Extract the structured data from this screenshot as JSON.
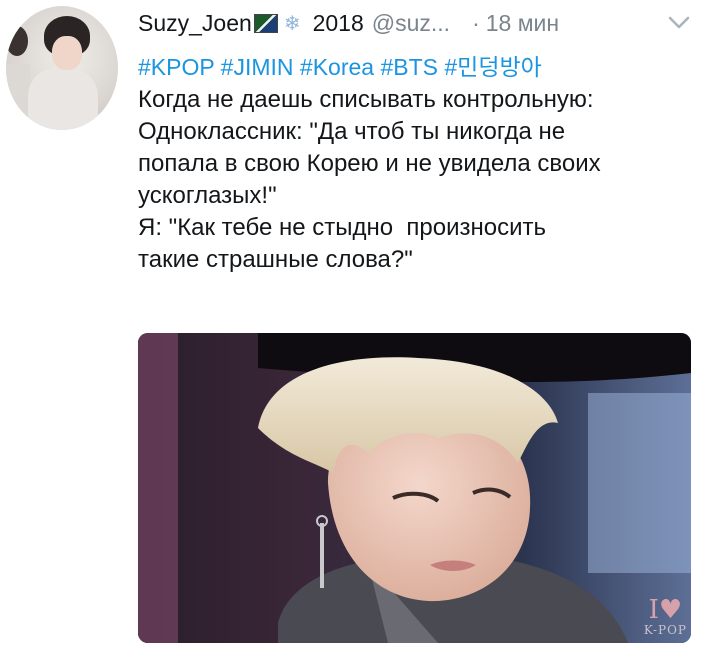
{
  "header": {
    "name": "Suzy_Joen",
    "year": "2018",
    "handle": "@suz...",
    "dot": "·",
    "time": "18 мин"
  },
  "hashtags": "#KPOP #JIMIN #Korea #BTS #민덩방아",
  "lines": [
    "Когда не даешь списывать контрольную:",
    "Одноклассник: \"Да чтоб ты никогда не",
    "попала в свою Корею и не увидела своих",
    "ускоглазых!\"",
    "Я: \"Как тебе не стыдно  произносить",
    "такие страшные слова?\""
  ],
  "media": {
    "watermark_symbol": "I",
    "watermark_text": "K-POP"
  },
  "icons": {
    "flag": "flag-icon",
    "snow": "snowflake-icon",
    "menu": "chevron-down-icon",
    "heart": "heart-icon"
  },
  "colors": {
    "link": "#1b95e0",
    "muted": "#7a848c",
    "text": "#14171a"
  }
}
